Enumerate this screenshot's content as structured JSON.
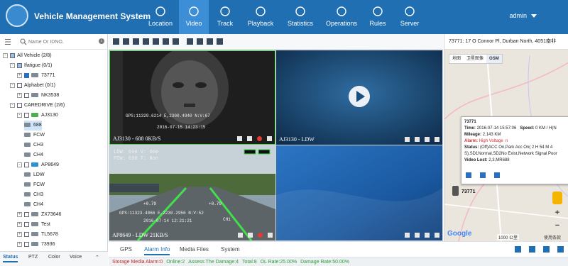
{
  "header": {
    "title": "Vehicle Management System",
    "nav": [
      {
        "label": "Location",
        "icon": "location-icon"
      },
      {
        "label": "Video",
        "icon": "play-icon",
        "active": true
      },
      {
        "label": "Track",
        "icon": "track-icon"
      },
      {
        "label": "Playback",
        "icon": "playback-icon"
      },
      {
        "label": "Statistics",
        "icon": "bar-chart-icon"
      },
      {
        "label": "Operations",
        "icon": "operations-icon"
      },
      {
        "label": "Rules",
        "icon": "rules-icon"
      },
      {
        "label": "Server",
        "icon": "server-icon"
      }
    ],
    "user": "admin"
  },
  "left": {
    "search_placeholder": "Name Or IDNO.",
    "tree": [
      {
        "label": "All Vehicle  (2/8)",
        "level": 0,
        "type": "group",
        "exp": "-",
        "check": "half"
      },
      {
        "label": "Ifatigue  (0/1)",
        "level": 1,
        "type": "group",
        "exp": "-",
        "check": "half"
      },
      {
        "label": "73771",
        "level": 2,
        "type": "vehicle",
        "exp": "+",
        "check": "on",
        "car": "grey"
      },
      {
        "label": "Alphabet  (0/1)",
        "level": 1,
        "type": "group",
        "exp": "-",
        "check": "off"
      },
      {
        "label": "NK3538",
        "level": 2,
        "type": "vehicle",
        "exp": "+",
        "check": "off",
        "car": "grey"
      },
      {
        "label": "CAREDRIVE  (2/6)",
        "level": 1,
        "type": "group",
        "exp": "-",
        "check": "off"
      },
      {
        "label": "AJ3130",
        "level": 2,
        "type": "vehicle",
        "exp": "-",
        "check": "off",
        "car": "green"
      },
      {
        "label": "688",
        "level": 3,
        "type": "channel",
        "selected": true
      },
      {
        "label": "FCW",
        "level": 3,
        "type": "channel"
      },
      {
        "label": "CH3",
        "level": 3,
        "type": "channel"
      },
      {
        "label": "CH4",
        "level": 3,
        "type": "channel"
      },
      {
        "label": "AP8649",
        "level": 2,
        "type": "vehicle",
        "exp": "-",
        "check": "off",
        "car": "blue"
      },
      {
        "label": "LDW",
        "level": 3,
        "type": "channel"
      },
      {
        "label": "FCW",
        "level": 3,
        "type": "channel"
      },
      {
        "label": "CH3",
        "level": 3,
        "type": "channel"
      },
      {
        "label": "CH4",
        "level": 3,
        "type": "channel"
      },
      {
        "label": "ZX73646",
        "level": 2,
        "type": "vehicle",
        "exp": "+",
        "check": "off",
        "car": "grey"
      },
      {
        "label": "Test",
        "level": 2,
        "type": "vehicle",
        "exp": "+",
        "check": "off",
        "car": "grey"
      },
      {
        "label": "TL5678",
        "level": 2,
        "type": "vehicle",
        "exp": "+",
        "check": "off",
        "car": "grey"
      },
      {
        "label": "73936",
        "level": 2,
        "type": "vehicle",
        "exp": "+",
        "check": "off",
        "car": "grey"
      }
    ],
    "tabs": [
      "Status",
      "PTZ",
      "Color",
      "Voice"
    ]
  },
  "videos": [
    {
      "label": "AJ3130 - 688  0KB/S",
      "osd1": "GPS:11329.6214 E,2300.4940 N:V:67",
      "osd2": "2016-07-15  14:23:15"
    },
    {
      "label": "AJ3130 - LDW"
    },
    {
      "label": "AP8649 - LDW 21KB/S",
      "osd1": "LDW: 030    V: 060",
      "osd2": "FCW: 030    T: Non",
      "osd3": "GPS:11323.4066 E,2230.2956 N:V:52",
      "osd4": "2016-07-14  12:21:21",
      "osd5": "CH1",
      "lane_left": "+0.79",
      "lane_right": "+0.79"
    },
    {
      "label": ""
    }
  ],
  "map": {
    "address": "73771: 17 O Connor Pl, Durban North, 4051南非",
    "types": [
      "地图",
      "卫星图像",
      "OSM"
    ],
    "popup": {
      "title": "73771",
      "time_label": "Time:",
      "time": "2016-07-14 15:57:06",
      "speed_label": "Speed:",
      "speed": "0 KM / H(N",
      "mileage_label": "Mileage:",
      "mileage": "2.143 KM",
      "alarm_label": "Alarm:",
      "alarm": "High Voltage  n",
      "status_label": "Status:",
      "status1": "(Off)ACC On,Park Acc On( 2 H 54 M 4",
      "status2": "S),SD1Normal,SD2No Exist,Network Signal Poor",
      "video_lost_label": "Video Lost:",
      "video_lost": "2,3,MR688"
    },
    "marker_label": "73771",
    "google": "Google",
    "scale": "1000 公里",
    "terms": "使用条款"
  },
  "bottom_tabs": [
    "GPS",
    "Alarm Info",
    "Media Files",
    "System"
  ],
  "status": [
    {
      "text": "Storage Media Alarm:0",
      "color": "red"
    },
    {
      "text": "Online:2",
      "color": "green"
    },
    {
      "text": "Assess The Damage:4",
      "color": "green"
    },
    {
      "text": "Total:8",
      "color": "green"
    },
    {
      "text": "OL Rate:25.00%",
      "color": "green"
    },
    {
      "text": "Damage Rate:50.00%",
      "color": "green"
    }
  ]
}
